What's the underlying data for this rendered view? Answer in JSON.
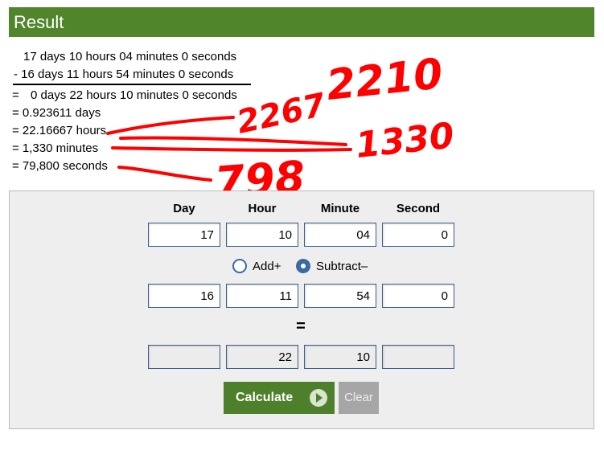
{
  "header": {
    "title": "Result"
  },
  "result": {
    "line1": "17 days 10 hours 04 minutes 0 seconds",
    "line2": "- 16 days 11 hours 54 minutes 0 seconds",
    "line3_eq": "=",
    "line3": "0 days 22 hours 10 minutes 0 seconds",
    "conv_days": "= 0.923611 days",
    "conv_hours": "= 22.16667 hours",
    "conv_minutes": "= 1,330 minutes",
    "conv_seconds": "= 79,800 seconds"
  },
  "handwriting": {
    "n1": "2210",
    "n2": "2267",
    "n3": "1330",
    "n4": "798",
    "color": "#ff0000"
  },
  "form": {
    "columns": [
      "Day",
      "Hour",
      "Minute",
      "Second"
    ],
    "first": [
      "17",
      "10",
      "04",
      "0"
    ],
    "second": [
      "16",
      "11",
      "54",
      "0"
    ],
    "result": [
      "",
      "22",
      "10",
      ""
    ],
    "op_add": "Add+",
    "op_subtract": "Subtract–",
    "selected_op": "subtract",
    "equals": "=",
    "calculate_label": "Calculate",
    "clear_label": "Clear"
  },
  "colors": {
    "header_bg": "#51852c",
    "calc_bg": "#4e7f2a",
    "clear_bg": "#a6a6a6",
    "radio": "#3b6aa0"
  }
}
